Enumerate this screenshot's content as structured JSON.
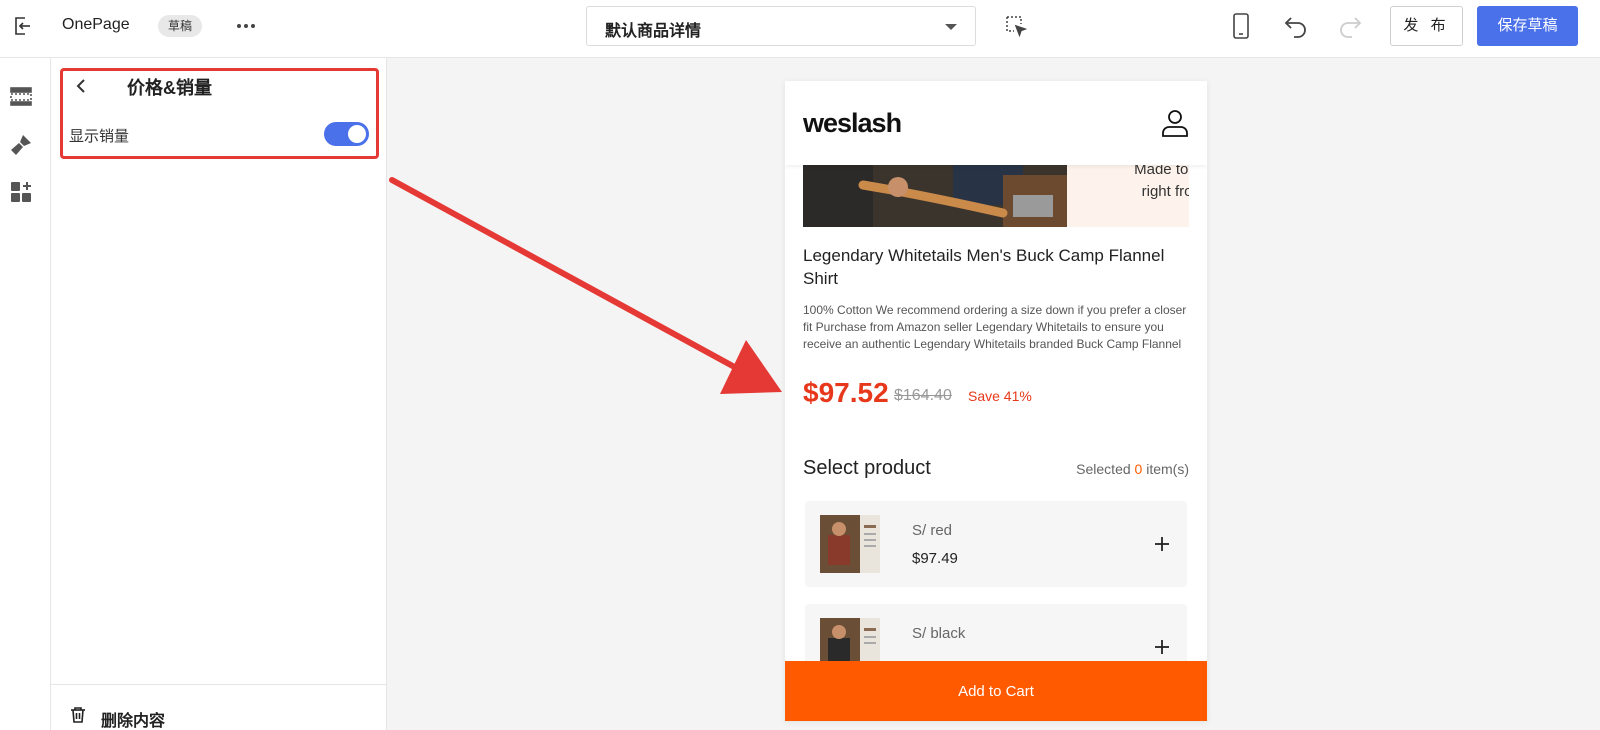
{
  "topbar": {
    "app_name": "OnePage",
    "status_badge": "草稿",
    "template_select": "默认商品详情",
    "publish_label": "发 布",
    "save_draft_label": "保存草稿"
  },
  "panel": {
    "title": "价格&销量",
    "show_sales_label": "显示销量",
    "show_sales_enabled": true,
    "delete_label": "删除内容"
  },
  "preview": {
    "logo": "weslash",
    "banner_text": "Made to Fi right from",
    "product_title": "Legendary Whitetails Men's Buck Camp Flannel Shirt",
    "description": "100% Cotton We recommend ordering a size down if you prefer a closer fit Purchase from Amazon seller Legendary Whitetails to ensure you receive an authentic Legendary Whitetails branded Buck Camp Flannel",
    "price": "$97.52",
    "compare_price": "$164.40",
    "save_text": "Save 41%",
    "select_title": "Select product",
    "selected_prefix": "Selected",
    "selected_count": "0",
    "selected_suffix": "item(s)",
    "variants": [
      {
        "name": "S/ red",
        "price": "$97.49"
      },
      {
        "name": "S/ black",
        "price": ""
      }
    ],
    "add_to_cart": "Add to Cart"
  },
  "colors": {
    "accent_blue": "#4a70ea",
    "price_red": "#e8381b",
    "cart_orange": "#ff5a00",
    "highlight_red": "#e53935"
  }
}
